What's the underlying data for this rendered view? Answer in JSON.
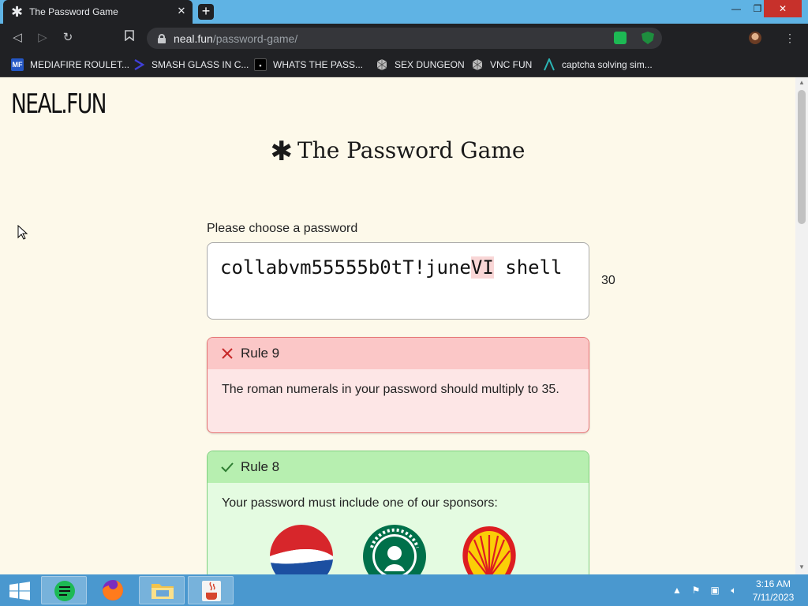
{
  "browser": {
    "tab_title": "The Password Game",
    "tab_icon": "asterisk-icon",
    "url_host": "neal.fun",
    "url_path": "/password-game/",
    "bookmarks": [
      {
        "label": "MEDIAFIRE ROULET...",
        "icon": "MF",
        "color": "#2457c5"
      },
      {
        "label": "SMASH GLASS IN C...",
        "icon": "",
        "color": "#3f3fd8"
      },
      {
        "label": "WHATS THE PASS...",
        "icon": "",
        "color": "#111111"
      },
      {
        "label": "SEX DUNGEON",
        "icon": "",
        "color": "#7a7a7a"
      },
      {
        "label": "VNC FUN",
        "icon": "",
        "color": "#7a7a7a"
      },
      {
        "label": "captcha solving sim...",
        "icon": "",
        "color": "#2bb5b5"
      }
    ]
  },
  "page": {
    "logo": "NEAL.FUN",
    "title": "The Password Game",
    "prompt_label": "Please choose a password",
    "password_pre": "collabvm55555b0tT!june",
    "password_hl": "VI",
    "password_post": " shell",
    "char_count": "30",
    "rules": [
      {
        "status": "fail",
        "title": "Rule 9",
        "text": "The roman numerals in your password should multiply to 35."
      },
      {
        "status": "pass",
        "title": "Rule 8",
        "text": "Your password must include one of our sponsors:"
      }
    ],
    "sponsors": [
      "pepsi-logo",
      "starbucks-logo",
      "shell-logo"
    ]
  },
  "taskbar": {
    "time": "3:16 AM",
    "date": "7/11/2023"
  }
}
